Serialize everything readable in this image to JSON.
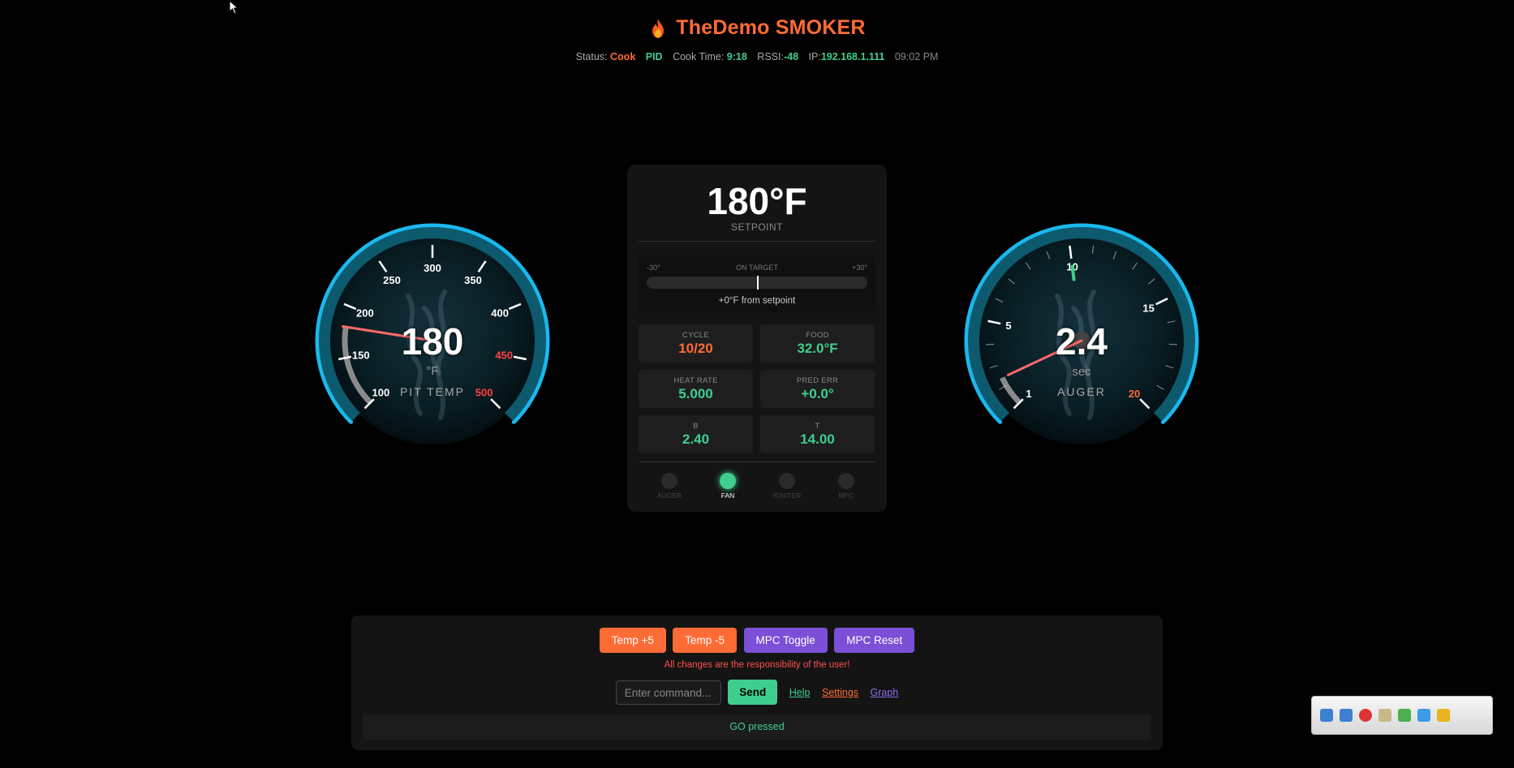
{
  "header": {
    "title": "TheDemo SMOKER",
    "status_label": "Status:",
    "status_value": "Cook",
    "mode": "PID",
    "cook_time_label": "Cook Time:",
    "cook_time_value": "9:18",
    "rssi_label": "RSSI:",
    "rssi_value": "-48",
    "ip_label": "IP:",
    "ip_value": "192.168.1.111",
    "clock": "09:02 PM"
  },
  "pit_gauge": {
    "value": "180",
    "unit": "°F",
    "label": "PIT TEMP",
    "min": 100,
    "max": 500,
    "current": 180,
    "setpoint": 180,
    "major_ticks": [
      "100",
      "150",
      "200",
      "250",
      "300",
      "350",
      "400",
      "450",
      "500"
    ],
    "hot_ticks": [
      "450",
      "500"
    ]
  },
  "auger_gauge": {
    "value": "2.4",
    "unit": "sec",
    "label": "AUGER",
    "min": 1,
    "max": 20,
    "current": 2.4,
    "marker": 10,
    "labeled_ticks": [
      "1",
      "5",
      "10",
      "15",
      "20"
    ]
  },
  "setpoint": {
    "value": "180°F",
    "label": "SETPOINT"
  },
  "target": {
    "min_label": "-30°",
    "center_label": "ON TARGET",
    "max_label": "+30°",
    "offset_fraction": 0.5,
    "diff_text": "+0°F from setpoint"
  },
  "stats": [
    {
      "label": "CYCLE",
      "value": "10/20",
      "color": "orange"
    },
    {
      "label": "FOOD",
      "value": "32.0°F",
      "color": "green"
    },
    {
      "label": "HEAT RATE",
      "value": "5.000",
      "color": "green"
    },
    {
      "label": "PRED ERR",
      "value": "+0.0°",
      "color": "green"
    },
    {
      "label": "B",
      "value": "2.40",
      "color": "green"
    },
    {
      "label": "T",
      "value": "14.00",
      "color": "green"
    }
  ],
  "indicators": [
    {
      "label": "AUGER",
      "on": false
    },
    {
      "label": "FAN",
      "on": true
    },
    {
      "label": "IGNITER",
      "on": false
    },
    {
      "label": "MPC",
      "on": false
    }
  ],
  "controls": {
    "temp_up": "Temp +5",
    "temp_down": "Temp -5",
    "mpc_toggle": "MPC Toggle",
    "mpc_reset": "MPC Reset",
    "warning": "All changes are the responsibility of the user!",
    "command_placeholder": "Enter command...",
    "send": "Send",
    "help": "Help",
    "settings": "Settings",
    "graph": "Graph",
    "message": "GO pressed"
  },
  "colors": {
    "accent_orange": "#ff6b35",
    "accent_green": "#3ecf8e",
    "accent_purple": "#7b4fd6",
    "gauge_ring": "#1ab8ee",
    "needle": "#ff6b6b"
  }
}
